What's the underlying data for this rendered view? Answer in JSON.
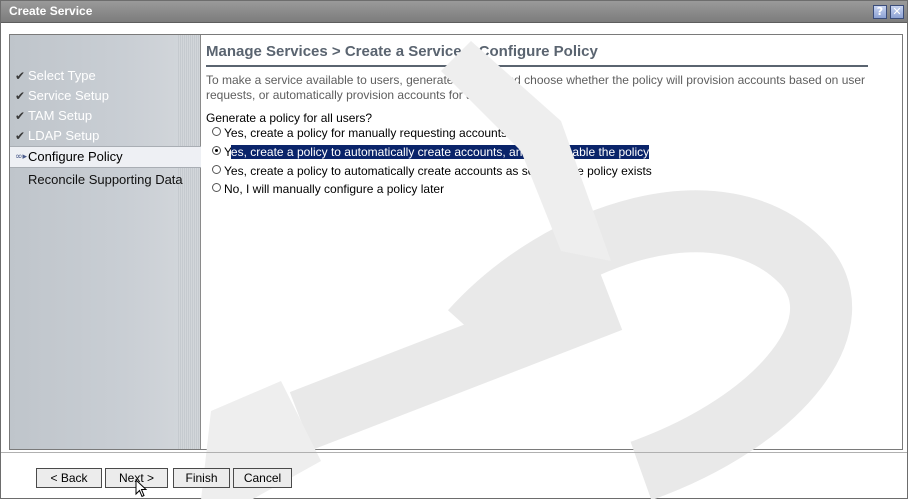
{
  "window": {
    "title": "Create Service",
    "help_label": "?",
    "close_label": "✕"
  },
  "sidebar": {
    "steps": [
      {
        "label": "Select Type",
        "state": "done"
      },
      {
        "label": "Service Setup",
        "state": "done"
      },
      {
        "label": "TAM Setup",
        "state": "done"
      },
      {
        "label": "LDAP Setup",
        "state": "done"
      },
      {
        "label": "Configure Policy",
        "state": "current"
      },
      {
        "label": "Reconcile Supporting Data",
        "state": "pending"
      }
    ]
  },
  "main": {
    "heading": "Manage Services > Create a Service > Configure Policy",
    "intro": "To make a service available to users, generate a policy and choose whether the policy will provision accounts based on user requests, or automatically provision accounts for all users.",
    "question": "Generate a policy for all users?",
    "options": [
      {
        "label": "Yes, create a policy for manually requesting accounts",
        "selected": false
      },
      {
        "label_first_char": "Y",
        "label_rest": "es, create a policy to automatically create accounts, and later enable the policy",
        "selected": true
      },
      {
        "label": "Yes, create a policy to automatically create accounts as soon as the policy exists",
        "selected": false
      },
      {
        "label": "No, I will manually configure a policy later",
        "selected": false
      }
    ]
  },
  "footer": {
    "back_label": "< Back",
    "next_label": "Next >",
    "finish_label": "Finish",
    "cancel_label": "Cancel"
  },
  "colors": {
    "selection": "#0a246a",
    "heading": "#5a6470",
    "sidebar_bg": "#c9ced4"
  }
}
